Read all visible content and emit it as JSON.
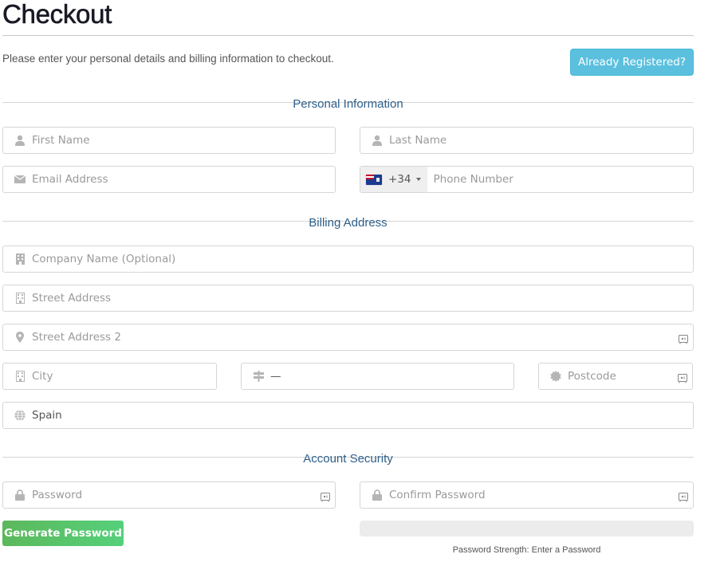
{
  "header": {
    "title": "Checkout",
    "intro": "Please enter your personal details and billing information to checkout.",
    "already_registered_label": "Already Registered?"
  },
  "colors": {
    "info_button": "#5bc0de",
    "success_button": "#5cb85c",
    "section_title": "#2e5f8a"
  },
  "sections": {
    "personal": "Personal Information",
    "billing": "Billing Address",
    "security": "Account Security"
  },
  "personal": {
    "first_name": {
      "placeholder": "First Name",
      "value": "",
      "icon": "user-icon"
    },
    "last_name": {
      "placeholder": "Last Name",
      "value": "",
      "icon": "user-icon"
    },
    "email": {
      "placeholder": "Email Address",
      "value": "",
      "icon": "envelope-icon"
    },
    "phone": {
      "placeholder": "Phone Number",
      "value": "",
      "dial_code": "+34",
      "flag": "flag-icon"
    }
  },
  "billing": {
    "company": {
      "placeholder": "Company Name (Optional)",
      "value": "",
      "icon": "building-icon"
    },
    "street": {
      "placeholder": "Street Address",
      "value": "",
      "icon": "building-icon"
    },
    "street2": {
      "placeholder": "Street Address 2",
      "value": "",
      "icon": "map-marker-icon"
    },
    "city": {
      "placeholder": "City",
      "value": "",
      "icon": "building-icon"
    },
    "state": {
      "placeholder": "",
      "value": "—",
      "icon": "signpost-icon"
    },
    "postcode": {
      "placeholder": "Postcode",
      "value": "",
      "icon": "certificate-icon"
    },
    "country": {
      "placeholder": "",
      "value": "Spain",
      "icon": "globe-icon"
    }
  },
  "security": {
    "password": {
      "placeholder": "Password",
      "value": "",
      "icon": "lock-icon"
    },
    "confirm_password": {
      "placeholder": "Confirm Password",
      "value": "",
      "icon": "lock-icon"
    },
    "generate_label": "Generate Password",
    "strength_percent": 0,
    "strength_text": "Password Strength: Enter a Password"
  }
}
